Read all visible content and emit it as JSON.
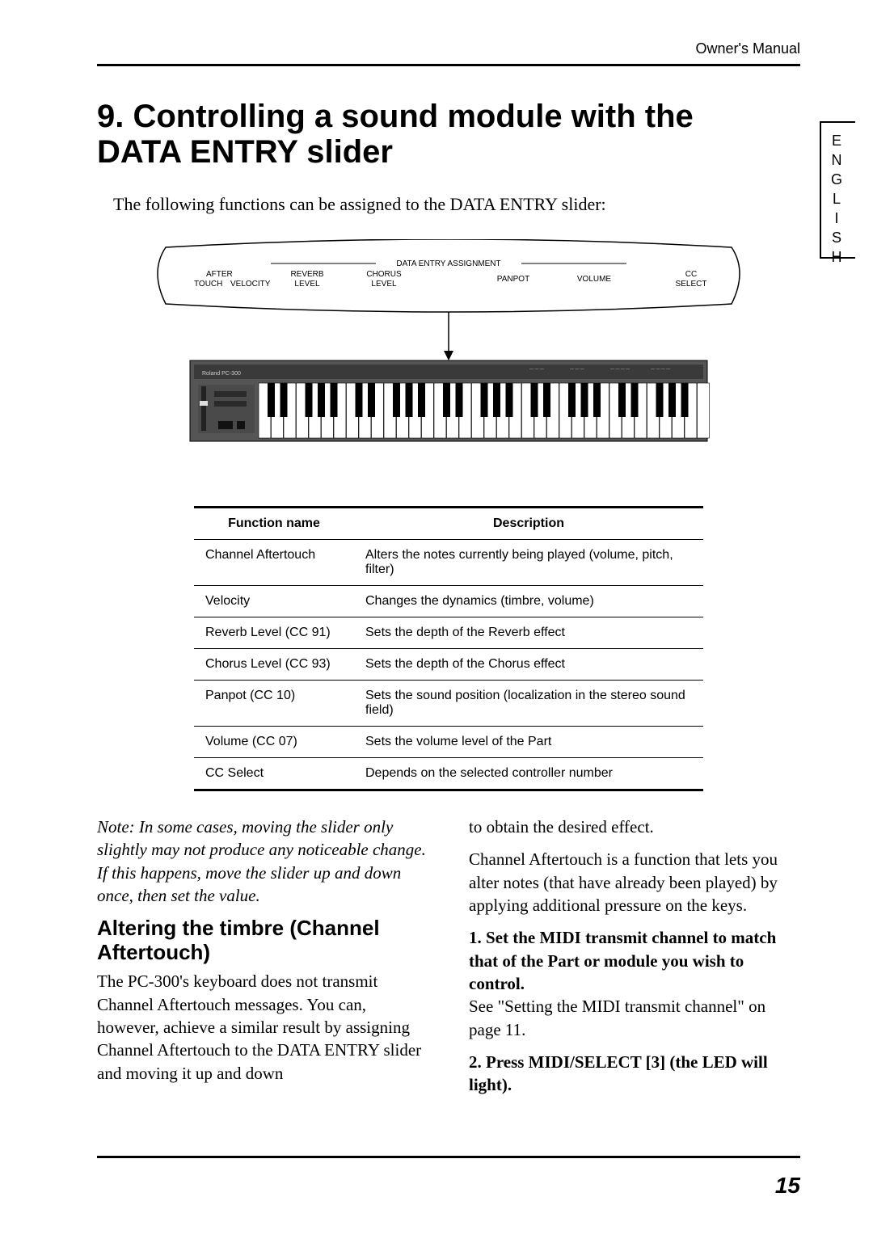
{
  "running_head": "Owner's Manual",
  "side_tab": "ENGLISH",
  "section_number": "9.",
  "section_title": "Controlling a sound module with the DATA ENTRY slider",
  "intro": "The following functions can be assigned to the DATA ENTRY slider:",
  "diagram": {
    "group_label": "DATA ENTRY ASSIGNMENT",
    "labels": [
      "AFTER TOUCH",
      "VELOCITY",
      "REVERB LEVEL",
      "CHORUS LEVEL",
      "PANPOT",
      "VOLUME",
      "CC SELECT"
    ],
    "device_label": "Roland PC-300"
  },
  "table": {
    "headers": [
      "Function name",
      "Description"
    ],
    "rows": [
      [
        "Channel Aftertouch",
        "Alters the notes currently being played (volume, pitch, filter)"
      ],
      [
        "Velocity",
        "Changes the dynamics (timbre, volume)"
      ],
      [
        "Reverb Level (CC 91)",
        "Sets the depth of the Reverb effect"
      ],
      [
        "Chorus Level (CC 93)",
        "Sets the depth of the Chorus effect"
      ],
      [
        "Panpot (CC 10)",
        "Sets the sound position (localization in the stereo sound field)"
      ],
      [
        "Volume (CC 07)",
        "Sets the volume level of the Part"
      ],
      [
        "CC Select",
        "Depends on the selected controller number"
      ]
    ]
  },
  "note": "Note: In some cases, moving the slider only slightly may not produce any noticeable change. If this happens, move the slider up and down once, then set the value.",
  "subhead": "Altering the timbre (Channel Aftertouch)",
  "col1_para": "The PC-300's keyboard does not transmit Channel Aftertouch messages. You can, however, achieve a similar result by assigning Channel Aftertouch to the DATA ENTRY slider and moving it up and down",
  "col2_cont": "to obtain the desired effect.",
  "col2_para": "Channel Aftertouch is a function that lets you alter notes (that have already been played) by applying additional pressure on the keys.",
  "step1_bold": "1. Set the MIDI transmit channel to match that of the Part or module you wish to control.",
  "step1_body": "See \"Setting the MIDI transmit channel\" on page 11.",
  "step2_bold": "2. Press MIDI/SELECT [3] (the LED will light).",
  "page_number": "15"
}
